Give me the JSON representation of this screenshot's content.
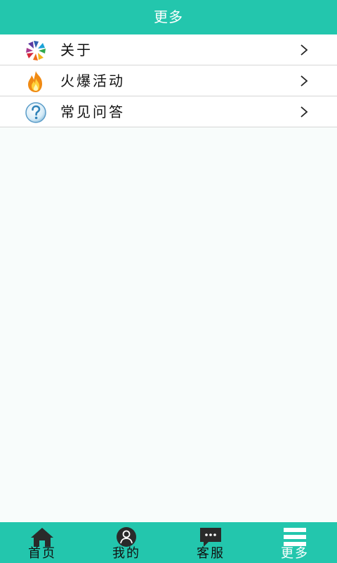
{
  "header": {
    "title": "更多"
  },
  "menu": {
    "items": [
      {
        "label": "关于",
        "icon": "pinwheel-icon"
      },
      {
        "label": "火爆活动",
        "icon": "fire-icon"
      },
      {
        "label": "常见问答",
        "icon": "question-icon"
      }
    ]
  },
  "tabbar": {
    "items": [
      {
        "label": "首页",
        "icon": "home-icon"
      },
      {
        "label": "我的",
        "icon": "user-icon"
      },
      {
        "label": "客服",
        "icon": "chat-icon"
      },
      {
        "label": "更多",
        "icon": "menu-icon",
        "active": true
      }
    ]
  },
  "colors": {
    "accent": "#23c6ad",
    "background": "#f8fcfb",
    "text": "#111111",
    "divider": "#d6d6d6"
  }
}
